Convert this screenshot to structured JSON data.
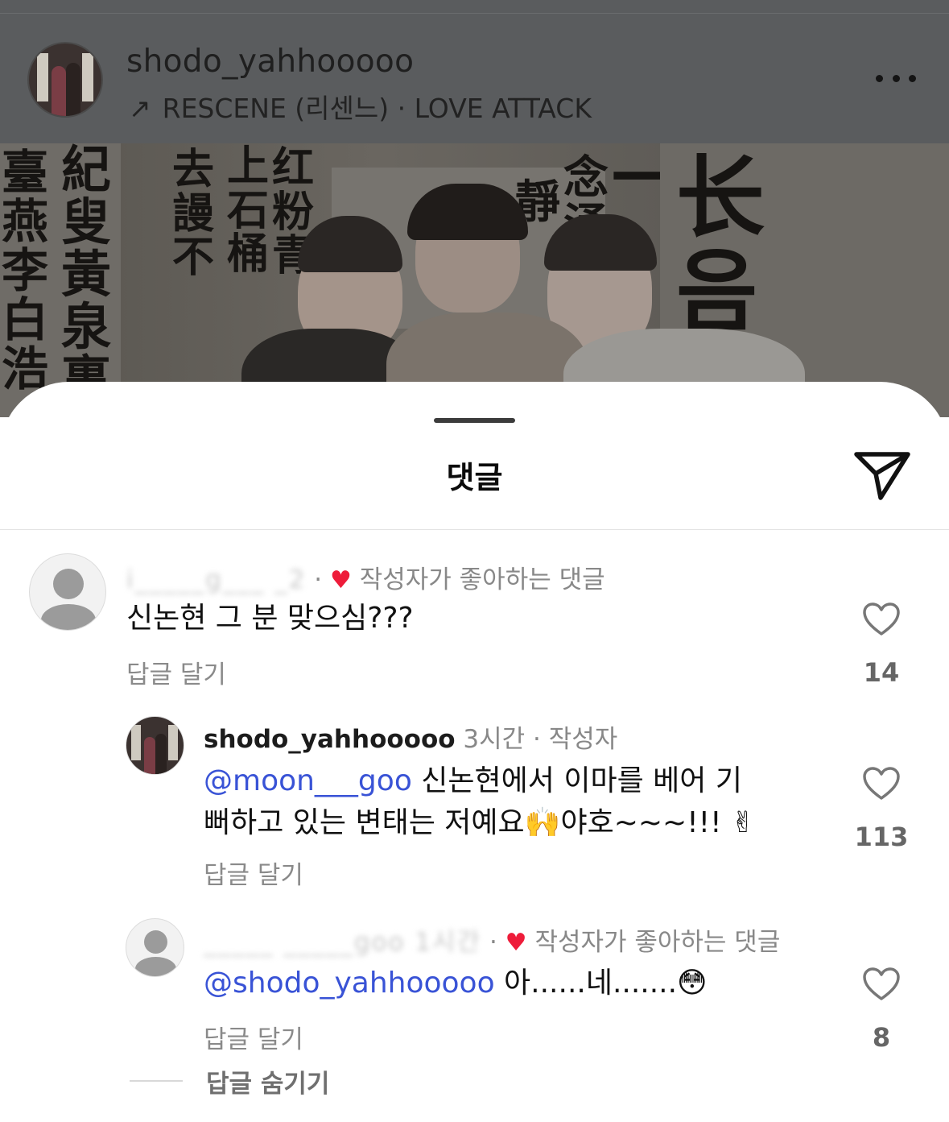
{
  "post": {
    "username": "shodo_yahhooooo",
    "audio": "RESCENE (리센느) · LOVE ATTACK",
    "audio_icon": "arrow-up-right-icon",
    "more_icon": "more-horizontal-icon"
  },
  "sheet": {
    "title": "댓글",
    "send_icon": "send-icon"
  },
  "comments": [
    {
      "user_blurred": "i_____g___ _2",
      "time": "",
      "liked_by_author_label": "작성자가 좋아하는 댓글",
      "text": "신논현 그 분 맞으심???",
      "reply_label": "답글 달기",
      "likes": "14"
    },
    {
      "user": "shodo_yahhooooo",
      "time": "3시간",
      "author_tag": "작성자",
      "mention": "@moon___goo",
      "text_line1": " 신논현에서 이마를 베어 기",
      "text_line2": "뻐하고 있는 변태는 저예요🙌야호~~~!!! ✌",
      "reply_label": "답글 달기",
      "likes": "113"
    },
    {
      "user_blurred": "_____ _____goo 1시간",
      "liked_by_author_label": "작성자가 좋아하는 댓글",
      "mention": "@shodo_yahhooooo",
      "text": " 아......네.......😳",
      "reply_label": "답글 달기",
      "likes": "8"
    }
  ],
  "hide_replies_label": "답글 숨기기",
  "colors": {
    "mention": "#3953d6",
    "liked_heart": "#ee1c3a",
    "overlay": "#5a5c5e"
  }
}
